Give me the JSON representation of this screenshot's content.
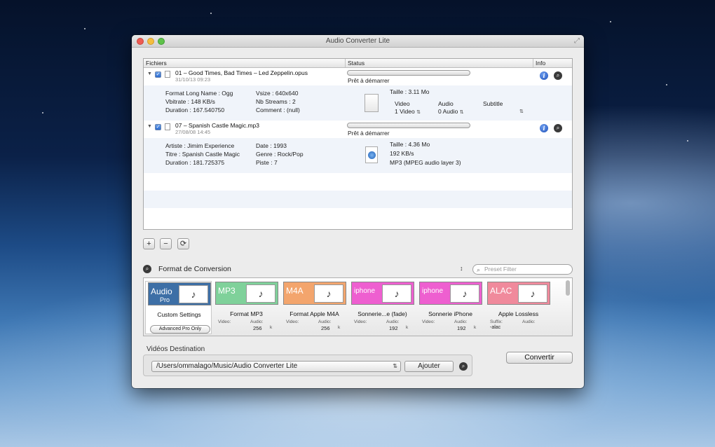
{
  "window": {
    "title": "Audio Converter Lite"
  },
  "columns": {
    "files": "Fichiers",
    "status": "Status",
    "info": "Info"
  },
  "files": [
    {
      "name": "01 – Good Times, Bad Times – Led Zeppelin.opus",
      "date": "31/10/13 09:23",
      "status": "Prêt à démarrer",
      "progress": 0,
      "meta": [
        "Format Long Name : Ogg",
        "Vbitrate : 148 KB/s",
        "Duration : 167.540750",
        "Vsize : 640x640",
        "Nb Streams : 2",
        "Comment : (null)"
      ],
      "size": "Taille : 3.11 Mo",
      "streams": {
        "video_label": "Video",
        "video_value": "1 Video",
        "audio_label": "Audio",
        "audio_value": "0 Audio",
        "subtitle_label": "Subtitle"
      }
    },
    {
      "name": "07 – Spanish Castle Magic.mp3",
      "date": "27/08/08 14:45",
      "status": "Prêt à démarrer",
      "progress": 0,
      "meta": [
        "Artiste : Jimim Experience",
        "Titre : Spanish Castle Magic",
        "Duration : 181.725375",
        "Date : 1993",
        "Genre : Rock/Pop",
        "Piste : 7"
      ],
      "size": "Taille : 4.36 Mo",
      "bitrate": "192 KB/s",
      "codec": "MP3 (MPEG audio layer 3)"
    }
  ],
  "list_buttons": {
    "add": "+",
    "remove": "−",
    "refresh": "⟳"
  },
  "format": {
    "title": "Format de Conversion",
    "filter_placeholder": "Preset Filter",
    "sort_glyph": "↕"
  },
  "presets": [
    {
      "badge": "Audio",
      "badge2": "Pro",
      "color": "#3d6fa6",
      "name": "Custom Settings",
      "button": "Advanced Pro Only"
    },
    {
      "badge": "MP3",
      "color": "#7fd19a",
      "name": "Format MP3",
      "video_label": "Video:",
      "audio_label": "Audio:",
      "audio_value": "256",
      "unit": "k"
    },
    {
      "badge": "M4A",
      "color": "#f3a56d",
      "name": "Format Apple M4A",
      "video_label": "Video:",
      "audio_label": "Audio:",
      "audio_value": "256",
      "unit": "k"
    },
    {
      "badge": "iphone",
      "color": "#ee5fd0",
      "name": "Sonnerie...e (fade)",
      "video_label": "Video:",
      "audio_label": "Audio:",
      "audio_value": "192",
      "unit": "k"
    },
    {
      "badge": "iphone",
      "color": "#ee5fd0",
      "name": "Sonnerie iPhone",
      "video_label": "Video:",
      "audio_label": "Audio:",
      "audio_value": "192",
      "unit": "k"
    },
    {
      "badge": "ALAC",
      "color": "#f08a9c",
      "name": "Apple Lossless",
      "video_label": "Suffix:",
      "suffix_value": "-alac",
      "audio_label": "Audio:"
    }
  ],
  "destination": {
    "label": "Vidéos Destination",
    "path": "/Users/ommalago/Music/Audio Converter Lite",
    "add_button": "Ajouter"
  },
  "convert_button": "Convertir"
}
